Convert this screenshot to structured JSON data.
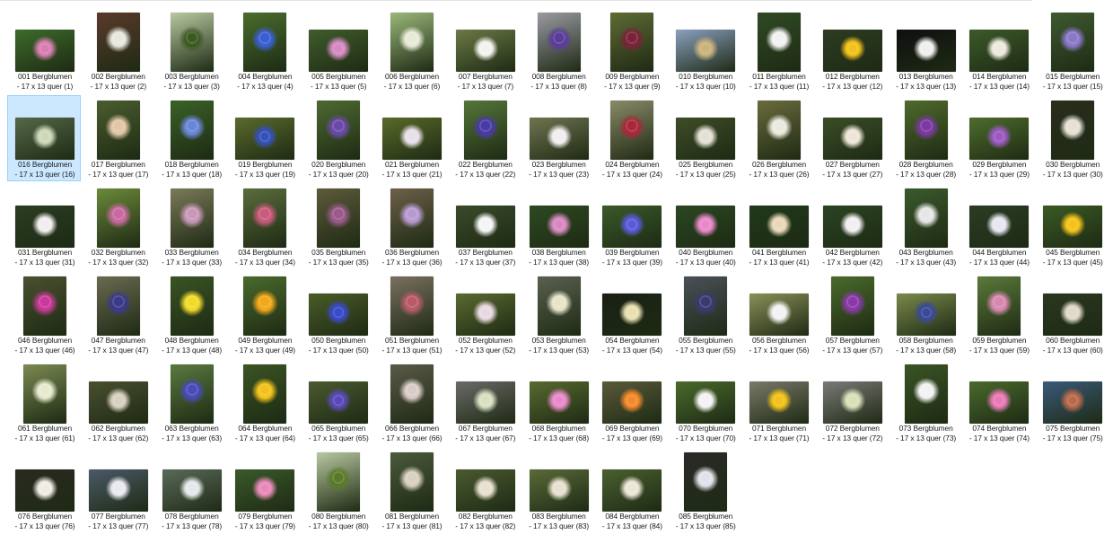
{
  "folder": {
    "items": [
      {
        "name": "001 Bergblumen - 17 x 13 quer (1)",
        "orientation": "land",
        "bg": "#3d6b2a",
        "accent": "#d77fb0",
        "selected": false
      },
      {
        "name": "002 Bergblumen - 17 x 13 quer (2)",
        "orientation": "port",
        "bg": "#5a3a2c",
        "accent": "#e8e8e0",
        "selected": false
      },
      {
        "name": "003 Bergblumen - 17 x 13 quer (3)",
        "orientation": "port",
        "bg": "#b8c9a0",
        "accent": "#3b5a22",
        "selected": false
      },
      {
        "name": "004 Bergblumen - 17 x 13 quer (4)",
        "orientation": "port",
        "bg": "#4a6d2d",
        "accent": "#3a5fd0",
        "selected": false
      },
      {
        "name": "005 Bergblumen - 17 x 13 quer (5)",
        "orientation": "land",
        "bg": "#3f5d2c",
        "accent": "#d58ac1",
        "selected": false
      },
      {
        "name": "006 Bergblumen - 17 x 13 quer (6)",
        "orientation": "port",
        "bg": "#9bb87a",
        "accent": "#e8ead8",
        "selected": false
      },
      {
        "name": "007 Bergblumen - 17 x 13 quer (7)",
        "orientation": "land",
        "bg": "#6b7a45",
        "accent": "#f4f2ee",
        "selected": false
      },
      {
        "name": "008 Bergblumen - 17 x 13 quer (8)",
        "orientation": "port",
        "bg": "#9a9aa2",
        "accent": "#5a3c9a",
        "selected": false
      },
      {
        "name": "009 Bergblumen - 17 x 13 quer (9)",
        "orientation": "port",
        "bg": "#5e6b34",
        "accent": "#7a2238",
        "selected": false
      },
      {
        "name": "010 Bergblumen - 17 x 13 quer (10)",
        "orientation": "land",
        "bg": "#8aa0c0",
        "accent": "#c9b37a",
        "selected": false
      },
      {
        "name": "011 Bergblumen - 17 x 13 quer (11)",
        "orientation": "port",
        "bg": "#2f4a24",
        "accent": "#f2f2f2",
        "selected": false
      },
      {
        "name": "012 Bergblumen - 17 x 13 quer (12)",
        "orientation": "land",
        "bg": "#2e3b22",
        "accent": "#f2c21a",
        "selected": false
      },
      {
        "name": "013 Bergblumen - 17 x 13 quer (13)",
        "orientation": "land",
        "bg": "#0f0f0f",
        "accent": "#f0f0f0",
        "selected": false
      },
      {
        "name": "014 Bergblumen - 17 x 13 quer (14)",
        "orientation": "land",
        "bg": "#3c5a2a",
        "accent": "#eceadf",
        "selected": false
      },
      {
        "name": "015 Bergblumen - 17 x 13 quer (15)",
        "orientation": "port",
        "bg": "#3e5a30",
        "accent": "#8a78c8",
        "selected": false
      },
      {
        "name": "016 Bergblumen - 17 x 13 quer (16)",
        "orientation": "land",
        "bg": "#556848",
        "accent": "#cdd8b8",
        "selected": true
      },
      {
        "name": "017 Bergblumen - 17 x 13 quer (17)",
        "orientation": "port",
        "bg": "#4a5d2e",
        "accent": "#e2c6a8",
        "selected": false
      },
      {
        "name": "018 Bergblumen - 17 x 13 quer (18)",
        "orientation": "port",
        "bg": "#3a6127",
        "accent": "#6a86d8",
        "selected": false
      },
      {
        "name": "019 Bergblumen - 17 x 13 quer (19)",
        "orientation": "land",
        "bg": "#5b6b2c",
        "accent": "#3552b8",
        "selected": false
      },
      {
        "name": "020 Bergblumen - 17 x 13 quer (20)",
        "orientation": "port",
        "bg": "#4d6a31",
        "accent": "#6a4aa8",
        "selected": false
      },
      {
        "name": "021 Bergblumen - 17 x 13 quer (21)",
        "orientation": "land",
        "bg": "#5a6a2a",
        "accent": "#e8e0e8",
        "selected": false
      },
      {
        "name": "022 Bergblumen - 17 x 13 quer (22)",
        "orientation": "port",
        "bg": "#55763a",
        "accent": "#4a3aa8",
        "selected": false
      },
      {
        "name": "023 Bergblumen - 17 x 13 quer (23)",
        "orientation": "land",
        "bg": "#6e7550",
        "accent": "#f2eef0",
        "selected": false
      },
      {
        "name": "024 Bergblumen - 17 x 13 quer (24)",
        "orientation": "port",
        "bg": "#8a8a68",
        "accent": "#a8283a",
        "selected": false
      },
      {
        "name": "025 Bergblumen - 17 x 13 quer (25)",
        "orientation": "land",
        "bg": "#3e4d27",
        "accent": "#e4e0d4",
        "selected": false
      },
      {
        "name": "026 Bergblumen - 17 x 13 quer (26)",
        "orientation": "port",
        "bg": "#6b6b3c",
        "accent": "#eceadf",
        "selected": false
      },
      {
        "name": "027 Bergblumen - 17 x 13 quer (27)",
        "orientation": "land",
        "bg": "#3a4d26",
        "accent": "#ede6d8",
        "selected": false
      },
      {
        "name": "028 Bergblumen - 17 x 13 quer (28)",
        "orientation": "port",
        "bg": "#4f6a2c",
        "accent": "#7a3aa0",
        "selected": false
      },
      {
        "name": "029 Bergblumen - 17 x 13 quer (29)",
        "orientation": "land",
        "bg": "#4d6d2c",
        "accent": "#9a5ac0",
        "selected": false
      },
      {
        "name": "030 Bergblumen - 17 x 13 quer (30)",
        "orientation": "port",
        "bg": "#2a2d1c",
        "accent": "#e6e1d4",
        "selected": false
      },
      {
        "name": "031 Bergblumen - 17 x 13 quer (31)",
        "orientation": "land",
        "bg": "#2a3d22",
        "accent": "#f2eef0",
        "selected": false
      },
      {
        "name": "032 Bergblumen - 17 x 13 quer (32)",
        "orientation": "port",
        "bg": "#6b8a3a",
        "accent": "#c86aa0",
        "selected": false
      },
      {
        "name": "033 Bergblumen - 17 x 13 quer (33)",
        "orientation": "port",
        "bg": "#7a7a58",
        "accent": "#c898b8",
        "selected": false
      },
      {
        "name": "034 Bergblumen - 17 x 13 quer (34)",
        "orientation": "port",
        "bg": "#5a6d3c",
        "accent": "#c85a7a",
        "selected": false
      },
      {
        "name": "035 Bergblumen - 17 x 13 quer (35)",
        "orientation": "port",
        "bg": "#5d5a3a",
        "accent": "#9a5a8a",
        "selected": false
      },
      {
        "name": "036 Bergblumen - 17 x 13 quer (36)",
        "orientation": "port",
        "bg": "#6d6048",
        "accent": "#b89ad0",
        "selected": false
      },
      {
        "name": "037 Bergblumen - 17 x 13 quer (37)",
        "orientation": "land",
        "bg": "#3a4a2a",
        "accent": "#f4f4f4",
        "selected": false
      },
      {
        "name": "038 Bergblumen - 17 x 13 quer (38)",
        "orientation": "land",
        "bg": "#2c4a22",
        "accent": "#d888c0",
        "selected": false
      },
      {
        "name": "039 Bergblumen - 17 x 13 quer (39)",
        "orientation": "land",
        "bg": "#3a5a2a",
        "accent": "#5a5ad8",
        "selected": false
      },
      {
        "name": "040 Bergblumen - 17 x 13 quer (40)",
        "orientation": "land",
        "bg": "#2a4822",
        "accent": "#e888c8",
        "selected": false
      },
      {
        "name": "041 Bergblumen - 17 x 13 quer (41)",
        "orientation": "land",
        "bg": "#1f3a1a",
        "accent": "#e8d8b8",
        "selected": false
      },
      {
        "name": "042 Bergblumen - 17 x 13 quer (42)",
        "orientation": "land",
        "bg": "#2a4422",
        "accent": "#f2eef2",
        "selected": false
      },
      {
        "name": "043 Bergblumen - 17 x 13 quer (43)",
        "orientation": "port",
        "bg": "#3a5a2c",
        "accent": "#e6e6e6",
        "selected": false
      },
      {
        "name": "044 Bergblumen - 17 x 13 quer (44)",
        "orientation": "land",
        "bg": "#2a3d24",
        "accent": "#e8e6f0",
        "selected": false
      },
      {
        "name": "045 Bergblumen - 17 x 13 quer (45)",
        "orientation": "land",
        "bg": "#3a5a24",
        "accent": "#f4c21a",
        "selected": false
      },
      {
        "name": "046 Bergblumen - 17 x 13 quer (46)",
        "orientation": "port",
        "bg": "#4a5030",
        "accent": "#c83a98",
        "selected": false
      },
      {
        "name": "047 Bergblumen - 17 x 13 quer (47)",
        "orientation": "port",
        "bg": "#6a6a50",
        "accent": "#3a3a8a",
        "selected": false
      },
      {
        "name": "048 Bergblumen - 17 x 13 quer (48)",
        "orientation": "port",
        "bg": "#3a5424",
        "accent": "#f2da2a",
        "selected": false
      },
      {
        "name": "049 Bergblumen - 17 x 13 quer (49)",
        "orientation": "port",
        "bg": "#4a6a2c",
        "accent": "#f2a81a",
        "selected": false
      },
      {
        "name": "050 Bergblumen - 17 x 13 quer (50)",
        "orientation": "land",
        "bg": "#4a5c28",
        "accent": "#3a4ac8",
        "selected": false
      },
      {
        "name": "051 Bergblumen - 17 x 13 quer (51)",
        "orientation": "port",
        "bg": "#7a7060",
        "accent": "#b85a6a",
        "selected": false
      },
      {
        "name": "052 Bergblumen - 17 x 13 quer (52)",
        "orientation": "land",
        "bg": "#5a6a30",
        "accent": "#e8d8e0",
        "selected": false
      },
      {
        "name": "053 Bergblumen - 17 x 13 quer (53)",
        "orientation": "port",
        "bg": "#5a6050",
        "accent": "#e8e4c8",
        "selected": false
      },
      {
        "name": "054 Bergblumen - 17 x 13 quer (54)",
        "orientation": "land",
        "bg": "#1a2014",
        "accent": "#e8e0b0",
        "selected": false
      },
      {
        "name": "055 Bergblumen - 17 x 13 quer (55)",
        "orientation": "port",
        "bg": "#4a5058",
        "accent": "#3a3a70",
        "selected": false
      },
      {
        "name": "056 Bergblumen - 17 x 13 quer (56)",
        "orientation": "land",
        "bg": "#8a9058",
        "accent": "#f2f2f2",
        "selected": false
      },
      {
        "name": "057 Bergblumen - 17 x 13 quer (57)",
        "orientation": "port",
        "bg": "#4a6a2c",
        "accent": "#8a3aa8",
        "selected": false
      },
      {
        "name": "058 Bergblumen - 17 x 13 quer (58)",
        "orientation": "land",
        "bg": "#7a8a4a",
        "accent": "#3a4a98",
        "selected": false
      },
      {
        "name": "059 Bergblumen - 17 x 13 quer (59)",
        "orientation": "port",
        "bg": "#5a7a3a",
        "accent": "#d888b0",
        "selected": false
      },
      {
        "name": "060 Bergblumen - 17 x 13 quer (60)",
        "orientation": "land",
        "bg": "#2a3820",
        "accent": "#e0d8c8",
        "selected": false
      },
      {
        "name": "061 Bergblumen - 17 x 13 quer (61)",
        "orientation": "port",
        "bg": "#7a8a50",
        "accent": "#e8ead0",
        "selected": false
      },
      {
        "name": "062 Bergblumen - 17 x 13 quer (62)",
        "orientation": "land",
        "bg": "#4a5030",
        "accent": "#d8d0c0",
        "selected": false
      },
      {
        "name": "063 Bergblumen - 17 x 13 quer (63)",
        "orientation": "port",
        "bg": "#5a7a40",
        "accent": "#4a4ab8",
        "selected": false
      },
      {
        "name": "064 Bergblumen - 17 x 13 quer (64)",
        "orientation": "port",
        "bg": "#3a5424",
        "accent": "#f2c21a",
        "selected": false
      },
      {
        "name": "065 Bergblumen - 17 x 13 quer (65)",
        "orientation": "land",
        "bg": "#4a5a30",
        "accent": "#5a4ab8",
        "selected": false
      },
      {
        "name": "066 Bergblumen - 17 x 13 quer (66)",
        "orientation": "port",
        "bg": "#5a5a48",
        "accent": "#d8ccc8",
        "selected": false
      },
      {
        "name": "067 Bergblumen - 17 x 13 quer (67)",
        "orientation": "land",
        "bg": "#6a6a68",
        "accent": "#d8e0c0",
        "selected": false
      },
      {
        "name": "068 Bergblumen - 17 x 13 quer (68)",
        "orientation": "land",
        "bg": "#5a6a30",
        "accent": "#e88ac8",
        "selected": false
      },
      {
        "name": "069 Bergblumen - 17 x 13 quer (69)",
        "orientation": "land",
        "bg": "#5a5a3a",
        "accent": "#f28a2a",
        "selected": false
      },
      {
        "name": "070 Bergblumen - 17 x 13 quer (70)",
        "orientation": "land",
        "bg": "#4a6a2c",
        "accent": "#f4f2f2",
        "selected": false
      },
      {
        "name": "071 Bergblumen - 17 x 13 quer (71)",
        "orientation": "land",
        "bg": "#7a7a6a",
        "accent": "#f2c21a",
        "selected": false
      },
      {
        "name": "072 Bergblumen - 17 x 13 quer (72)",
        "orientation": "land",
        "bg": "#7a7a78",
        "accent": "#d8e0b8",
        "selected": false
      },
      {
        "name": "073 Bergblumen - 17 x 13 quer (73)",
        "orientation": "port",
        "bg": "#3a5424",
        "accent": "#f2f2f2",
        "selected": false
      },
      {
        "name": "074 Bergblumen - 17 x 13 quer (74)",
        "orientation": "land",
        "bg": "#4a6a2c",
        "accent": "#e87ab8",
        "selected": false
      },
      {
        "name": "075 Bergblumen - 17 x 13 quer (75)",
        "orientation": "land",
        "bg": "#3a5a7a",
        "accent": "#b86a4a",
        "selected": false
      },
      {
        "name": "076 Bergblumen - 17 x 13 quer (76)",
        "orientation": "land",
        "bg": "#2a2a20",
        "accent": "#f0ece4",
        "selected": false
      },
      {
        "name": "077 Bergblumen - 17 x 13 quer (77)",
        "orientation": "land",
        "bg": "#4a5a68",
        "accent": "#e8eaf0",
        "selected": false
      },
      {
        "name": "078 Bergblumen - 17 x 13 quer (78)",
        "orientation": "land",
        "bg": "#5a6a5a",
        "accent": "#e6e8ec",
        "selected": false
      },
      {
        "name": "079 Bergblumen - 17 x 13 quer (79)",
        "orientation": "land",
        "bg": "#3a5a2a",
        "accent": "#e88ab8",
        "selected": false
      },
      {
        "name": "080 Bergblumen - 17 x 13 quer (80)",
        "orientation": "port",
        "bg": "#b8c8a0",
        "accent": "#5a7a2a",
        "selected": false
      },
      {
        "name": "081 Bergblumen - 17 x 13 quer (81)",
        "orientation": "port",
        "bg": "#4a5a3a",
        "accent": "#d8d0c0",
        "selected": false
      },
      {
        "name": "082 Bergblumen - 17 x 13 quer (82)",
        "orientation": "land",
        "bg": "#4a5a30",
        "accent": "#e8e0d0",
        "selected": false
      },
      {
        "name": "083  Bergblumen - 17 x 13 quer (83)",
        "orientation": "land",
        "bg": "#5a6a38",
        "accent": "#e8e0d0",
        "selected": false
      },
      {
        "name": "084 Bergblumen - 17 x 13 quer (84)",
        "orientation": "land",
        "bg": "#4a6030",
        "accent": "#ece6d8",
        "selected": false
      },
      {
        "name": "085 Bergblumen - 17 x 13 quer (85)",
        "orientation": "port",
        "bg": "#2a2a28",
        "accent": "#e0e4ea",
        "selected": false
      }
    ]
  }
}
